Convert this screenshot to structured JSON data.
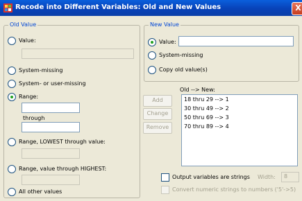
{
  "window": {
    "title": "Recode into Different Variables: Old and New Values",
    "close": "X"
  },
  "old_value": {
    "group_label": "Old Value",
    "value_label": "Value:",
    "system_missing": "System-missing",
    "system_or_user_missing": "System- or user-missing",
    "range_label": "Range:",
    "through": "through",
    "range_lowest": "Range, LOWEST through value:",
    "range_highest": "Range, value through HIGHEST:",
    "all_other": "All other values"
  },
  "new_value": {
    "group_label": "New Value",
    "value_label": "Value:",
    "system_missing": "System-missing",
    "copy_old": "Copy old value(s)"
  },
  "old_new": {
    "list_label": "Old --> New:",
    "items": [
      "18 thru 29 --> 1",
      "30 thru 49 --> 2",
      "50 thru 69 --> 3",
      "70 thru 89 --> 4"
    ],
    "buttons": {
      "add": "Add",
      "change": "Change",
      "remove": "Remove"
    }
  },
  "options": {
    "output_strings": "Output variables are strings",
    "width_label": "Width:",
    "width_value": "8",
    "convert_numeric": "Convert numeric strings to numbers ('5'->5)"
  }
}
